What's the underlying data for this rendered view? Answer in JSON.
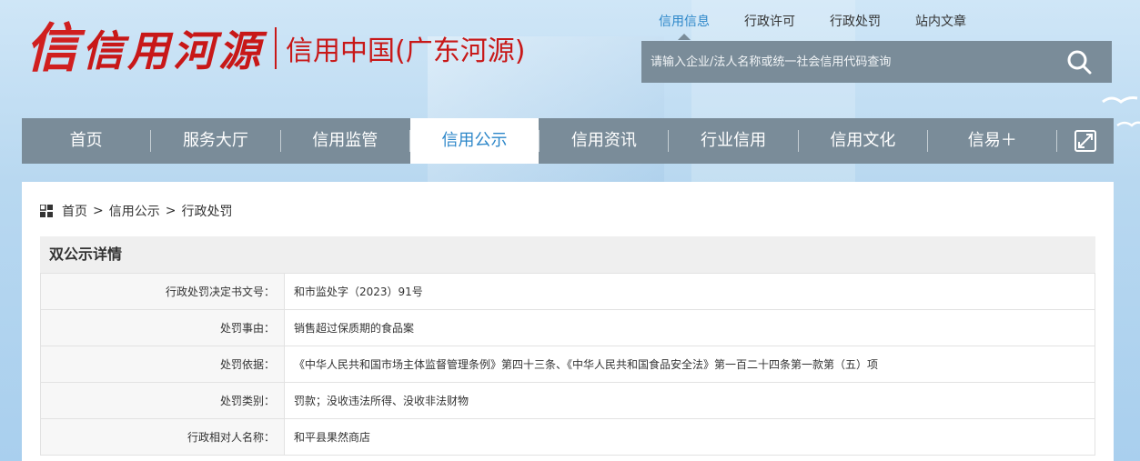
{
  "logo": {
    "mark": "信",
    "text": "信用河源",
    "subtitle": "信用中国(广东河源)"
  },
  "top_nav": [
    {
      "label": "信用信息",
      "active": true
    },
    {
      "label": "行政许可",
      "active": false
    },
    {
      "label": "行政处罚",
      "active": false
    },
    {
      "label": "站内文章",
      "active": false
    }
  ],
  "search": {
    "placeholder": "请输入企业/法人名称或统一社会信用代码查询",
    "icon": "search-icon"
  },
  "main_nav": [
    {
      "label": "首页"
    },
    {
      "label": "服务大厅"
    },
    {
      "label": "信用监管"
    },
    {
      "label": "信用公示",
      "active": true
    },
    {
      "label": "信用资讯"
    },
    {
      "label": "行业信用"
    },
    {
      "label": "信用文化"
    },
    {
      "label": "信易＋"
    }
  ],
  "breadcrumb": [
    "首页",
    "信用公示",
    "行政处罚"
  ],
  "breadcrumb_sep": ">",
  "detail": {
    "title": "双公示详情",
    "rows": [
      {
        "key": "行政处罚决定书文号：",
        "value": "和市监处字（2023）91号"
      },
      {
        "key": "处罚事由：",
        "value": "销售超过保质期的食品案"
      },
      {
        "key": "处罚依据：",
        "value": "《中华人民共和国市场主体监督管理条例》第四十三条、《中华人民共和国食品安全法》第一百二十四条第一款第（五）项"
      },
      {
        "key": "处罚类别：",
        "value": "罚款；没收违法所得、没收非法财物"
      },
      {
        "key": "行政相对人名称：",
        "value": "和平县果然商店"
      }
    ]
  },
  "colors": {
    "nav_bg": "#7a8c99",
    "accent": "#2d87c9",
    "logo_red": "#c81818"
  }
}
